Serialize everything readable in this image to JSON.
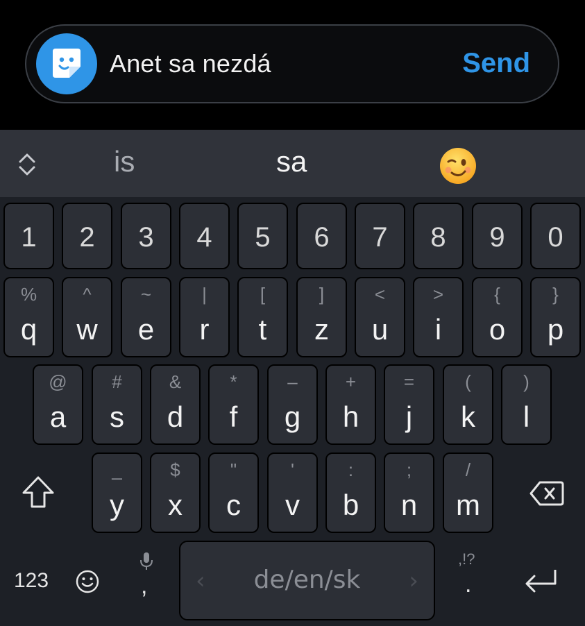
{
  "compose": {
    "text": "Anet sa nezdá",
    "send_label": "Send",
    "sticker_icon": "sticker-icon",
    "accent": "#2f95e7"
  },
  "suggestions": {
    "left": "is",
    "middle": "sa",
    "emoji": "winking-face"
  },
  "rows": {
    "numbers": [
      "1",
      "2",
      "3",
      "4",
      "5",
      "6",
      "7",
      "8",
      "9",
      "0"
    ],
    "top": [
      {
        "main": "q",
        "alt": "%"
      },
      {
        "main": "w",
        "alt": "^"
      },
      {
        "main": "e",
        "alt": "~"
      },
      {
        "main": "r",
        "alt": "|"
      },
      {
        "main": "t",
        "alt": "["
      },
      {
        "main": "z",
        "alt": "]"
      },
      {
        "main": "u",
        "alt": "<"
      },
      {
        "main": "i",
        "alt": ">"
      },
      {
        "main": "o",
        "alt": "{"
      },
      {
        "main": "p",
        "alt": "}"
      }
    ],
    "middle": [
      {
        "main": "a",
        "alt": "@"
      },
      {
        "main": "s",
        "alt": "#"
      },
      {
        "main": "d",
        "alt": "&"
      },
      {
        "main": "f",
        "alt": "*"
      },
      {
        "main": "g",
        "alt": "–"
      },
      {
        "main": "h",
        "alt": "+"
      },
      {
        "main": "j",
        "alt": "="
      },
      {
        "main": "k",
        "alt": "("
      },
      {
        "main": "l",
        "alt": ")"
      }
    ],
    "bottom": [
      {
        "main": "y",
        "alt": "_"
      },
      {
        "main": "x",
        "alt": "$"
      },
      {
        "main": "c",
        "alt": "\""
      },
      {
        "main": "v",
        "alt": "'"
      },
      {
        "main": "b",
        "alt": ":"
      },
      {
        "main": "n",
        "alt": ";"
      },
      {
        "main": "m",
        "alt": "/"
      }
    ]
  },
  "function_row": {
    "numbers_label": "123",
    "comma": ",",
    "space_label": "de/en/sk",
    "period": ".",
    "punct_hint": ",!?"
  }
}
